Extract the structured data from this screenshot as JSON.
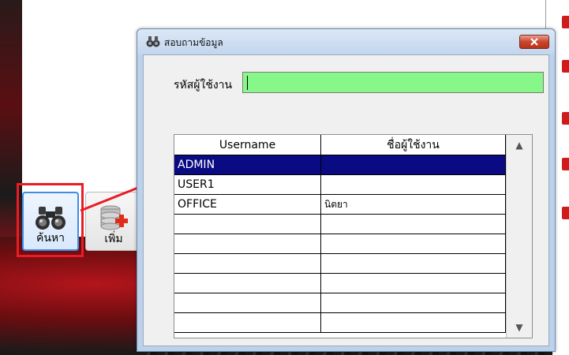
{
  "toolbar": {
    "search_label": "ค้นหา",
    "add_label": "เพิ่ม"
  },
  "dialog": {
    "title": "สอบถามข้อมูล",
    "field_label": "รหัสผู้ใช้งาน",
    "field_value": ""
  },
  "grid": {
    "columns": [
      "Username",
      "ชื่อผู้ใช้งาน"
    ],
    "rows": [
      {
        "username": "ADMIN",
        "name": ""
      },
      {
        "username": "USER1",
        "name": ""
      },
      {
        "username": "OFFICE",
        "name": "นิตยา"
      },
      {
        "username": "",
        "name": ""
      },
      {
        "username": "",
        "name": ""
      },
      {
        "username": "",
        "name": ""
      },
      {
        "username": "",
        "name": ""
      },
      {
        "username": "",
        "name": ""
      },
      {
        "username": "",
        "name": ""
      }
    ],
    "selected_row": 0
  },
  "colors": {
    "field_bg": "#88f78a",
    "selection": "#0a0a82",
    "highlight": "#ea1c24"
  }
}
